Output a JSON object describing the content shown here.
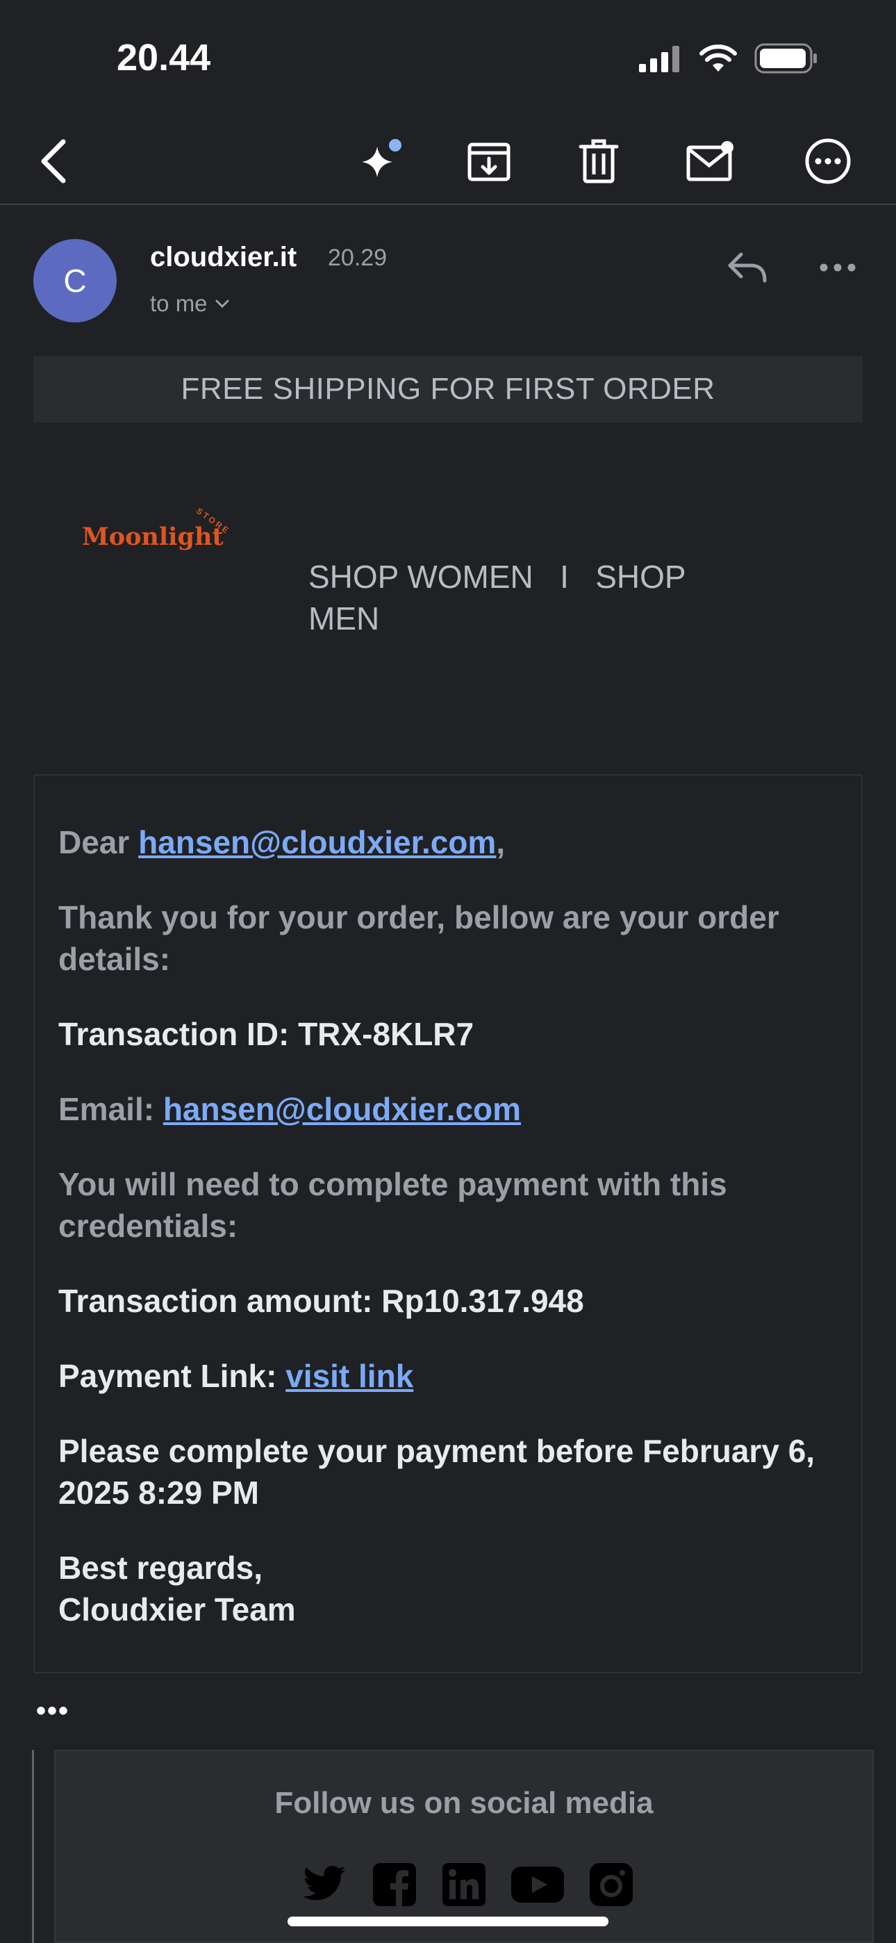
{
  "status_bar": {
    "time": "20.44"
  },
  "toolbar": {
    "icons": [
      "back-arrow-icon",
      "sparkle-icon",
      "archive-icon",
      "trash-icon",
      "mark-unread-icon",
      "more-circle-icon"
    ]
  },
  "sender": {
    "avatar_letter": "C",
    "name": "cloudxier.it",
    "time": "20.29",
    "recipient": "to me",
    "avatar_color": "#5c6bc0"
  },
  "email": {
    "banner": "FREE SHIPPING FOR FIRST ORDER",
    "logo": {
      "name": "Moonlight",
      "tag": "STORE"
    },
    "nav": {
      "shop_women": "SHOP WOMEN",
      "separator": "I",
      "shop_men": "SHOP MEN"
    },
    "greeting_prefix": "Dear ",
    "greeting_email": "hansen@cloudxier.com",
    "greeting_suffix": ",",
    "thanks": "Thank you for your order, bellow are your order details:",
    "transaction_id": "Transaction ID: TRX-8KLR7",
    "email_label": "Email: ",
    "email_value": "hansen@cloudxier.com",
    "payment_note": "You will need to complete payment with this credentials:",
    "amount": "Transaction amount: Rp10.317.948",
    "payment_link_label": "Payment Link: ",
    "payment_link_text": "visit link",
    "deadline": "Please complete your payment before February 6, 2025 8:29 PM",
    "regards": "Best regards,",
    "team": "Cloudxier Team",
    "ellipsis": "•••"
  },
  "footer": {
    "follow": "Follow us on social media",
    "socials": [
      "twitter-icon",
      "facebook-icon",
      "linkedin-icon",
      "youtube-icon",
      "instagram-icon"
    ]
  },
  "colors": {
    "background": "#202124",
    "link": "#7baaf7",
    "logo": "#e0551f"
  }
}
